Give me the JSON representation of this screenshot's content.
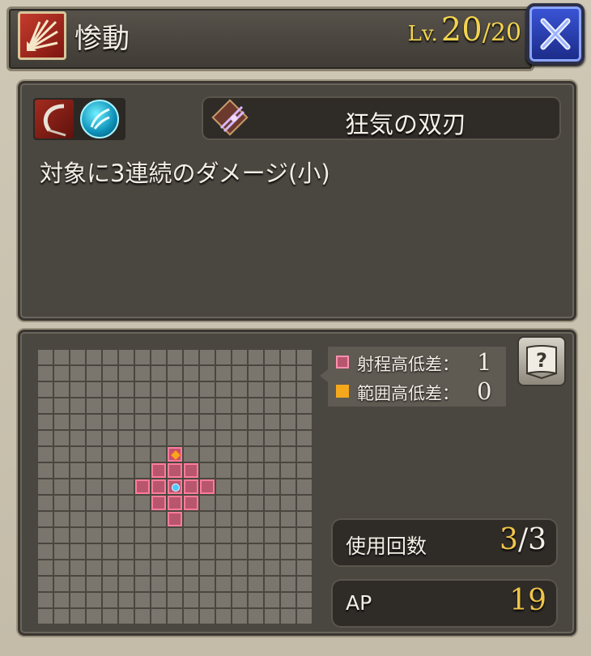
{
  "header": {
    "skill_name": "惨動",
    "level_label": "Lv.",
    "level_current": "20",
    "level_separator": "/",
    "level_max": "20",
    "type_icon": "claw-slash-icon",
    "close_icon": "close-x-icon"
  },
  "ability": {
    "weapon_icon": "scythe-icon",
    "element_icon": "wind-element-icon",
    "ability_icon": "twin-blade-icon",
    "name": "狂気の双刃",
    "description": "対象に3連続のダメージ(小)"
  },
  "range": {
    "legend": [
      {
        "label": "射程高低差：",
        "value": "1",
        "color": "#e0567a"
      },
      {
        "label": "範囲高低差：",
        "value": "0",
        "color": "#f5a81c"
      }
    ],
    "help_icon": "help-book-icon"
  },
  "stats": {
    "uses_label": "使用回数",
    "uses_current": "3",
    "uses_separator": "/",
    "uses_max": "3",
    "ap_label": "AP",
    "ap_value": "19"
  }
}
